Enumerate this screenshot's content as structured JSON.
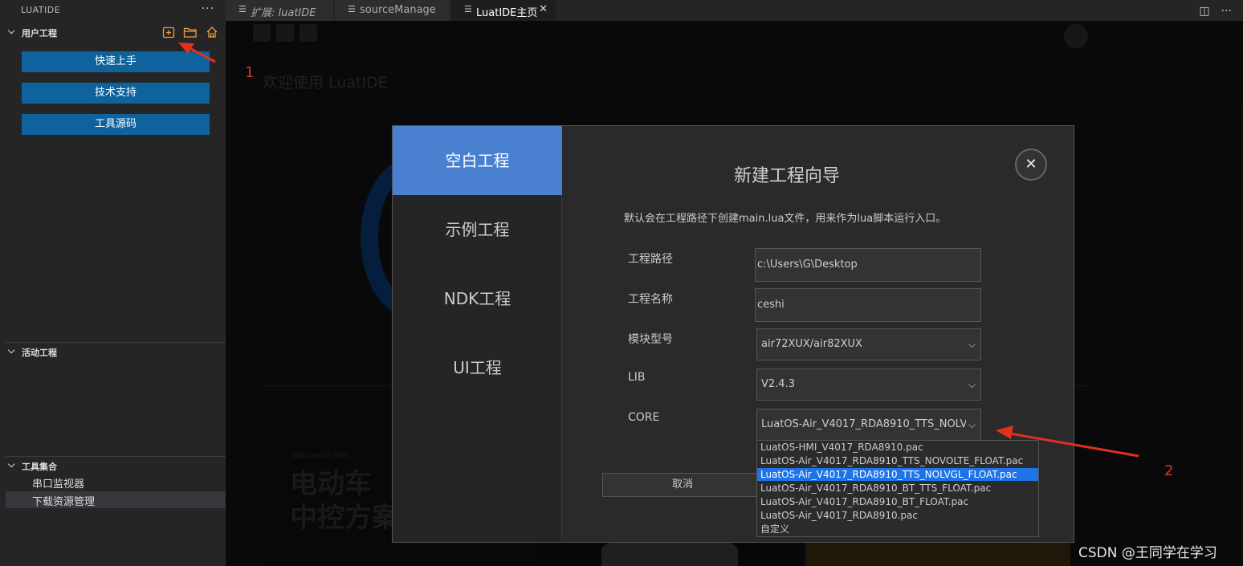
{
  "sidebar": {
    "title": "LUATIDE",
    "more": "···",
    "user_section": "用户工程",
    "buttons": [
      "快速上手",
      "技术支持",
      "工具源码"
    ],
    "active_section": "活动工程",
    "tools_section": "工具集合",
    "tools": [
      "串口监视器",
      "下载资源管理"
    ]
  },
  "tabs": [
    {
      "label": "扩展: luatIDE"
    },
    {
      "label": "sourceManage"
    },
    {
      "label": "LuatIDE主页"
    }
  ],
  "main": {
    "welcome": "欢迎使用 LuatIDE",
    "card1_small": "合宙LuatOS-HMI",
    "card1_big": "电动车\n中控方案"
  },
  "dialog": {
    "nav": [
      "空白工程",
      "示例工程",
      "NDK工程",
      "UI工程"
    ],
    "title": "新建工程向导",
    "close": "✕",
    "description": "默认会在工程路径下创建main.lua文件，用来作为lua脚本运行入口。",
    "fields": {
      "path_label": "工程路径",
      "path_value": "c:\\Users\\G\\Desktop",
      "name_label": "工程名称",
      "name_value": "ceshi",
      "module_label": "模块型号",
      "module_value": "air72XUX/air82XUX",
      "lib_label": "LIB",
      "lib_value": "V2.4.3",
      "core_label": "CORE",
      "core_value": "LuatOS-Air_V4017_RDA8910_TTS_NOLVGL_FLOAT.pac"
    },
    "cancel": "取消"
  },
  "core_options": [
    "LuatOS-HMI_V4017_RDA8910.pac",
    "LuatOS-Air_V4017_RDA8910_TTS_NOVOLTE_FLOAT.pac",
    "LuatOS-Air_V4017_RDA8910_TTS_NOLVGL_FLOAT.pac",
    "LuatOS-Air_V4017_RDA8910_BT_TTS_FLOAT.pac",
    "LuatOS-Air_V4017_RDA8910_BT_FLOAT.pac",
    "LuatOS-Air_V4017_RDA8910.pac",
    "自定义"
  ],
  "selected_core_index": 2,
  "annotations": {
    "num1": "1",
    "num2": "2"
  },
  "watermark": "CSDN @王同学在学习",
  "colors": {
    "accent": "#0e639c",
    "dialog_active": "#4a80d0",
    "annotation": "#e03020",
    "icon_orange": "#e8a040"
  }
}
